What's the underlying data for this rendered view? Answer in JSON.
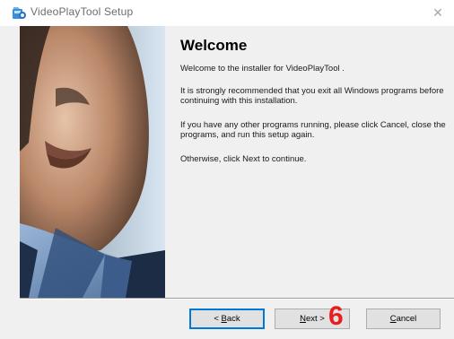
{
  "window": {
    "title": "VideoPlayTool Setup",
    "close_glyph": "✕"
  },
  "icons": {
    "app_icon": "installer-app-icon",
    "close": "close-icon"
  },
  "welcome": {
    "heading": "Welcome",
    "intro": "Welcome to the installer for VideoPlayTool .",
    "recommend": "It is strongly recommended that you exit all Windows programs before continuing with this installation.",
    "running": "If you have any other programs running, please click Cancel, close the programs, and run this setup again.",
    "otherwise": "Otherwise, click Next to continue."
  },
  "buttons": {
    "back_label_mnemonic": "B",
    "back_label_rest": "ack",
    "back_prefix": "< ",
    "next_label_mnemonic": "N",
    "next_label_rest": "ext >",
    "cancel_label_mnemonic": "C",
    "cancel_label_rest": "ancel"
  },
  "annotation": {
    "step_number": "6"
  },
  "colors": {
    "focus_border": "#0078d7",
    "step_marker": "#e81d1d",
    "dialog_background": "#f0f0f0"
  }
}
